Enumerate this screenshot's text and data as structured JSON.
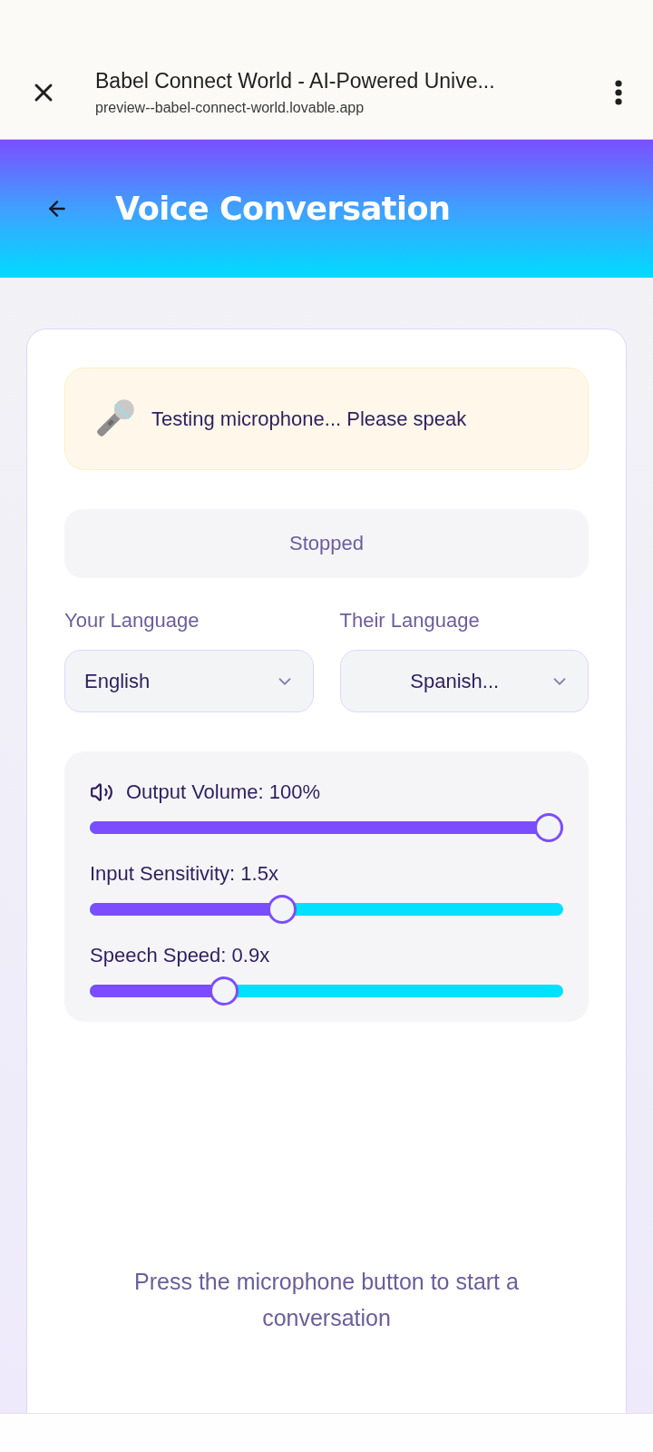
{
  "browser_bar": {
    "title": "Babel Connect World - AI-Powered Unive...",
    "url": "preview--babel-connect-world.lovable.app"
  },
  "header": {
    "title": "Voice Conversation"
  },
  "banner": {
    "message": "Testing microphone... Please speak"
  },
  "status": {
    "label": "Stopped"
  },
  "languages": [
    {
      "kind": "left",
      "label": "Your Language",
      "value": "English"
    },
    {
      "kind": "centered",
      "label": "Their Language",
      "value": "Spanish..."
    }
  ],
  "sliders": [
    {
      "kind": "volume",
      "label": "Output Volume: 100%",
      "level": 1
    },
    {
      "kind": "plain",
      "label": "Input Sensitivity: 1.5x",
      "level": 0.4
    },
    {
      "kind": "plain",
      "label": "Speech Speed: 0.9x",
      "level": 0.27
    }
  ],
  "hint": {
    "text": "Press the microphone button to start a conversation"
  }
}
